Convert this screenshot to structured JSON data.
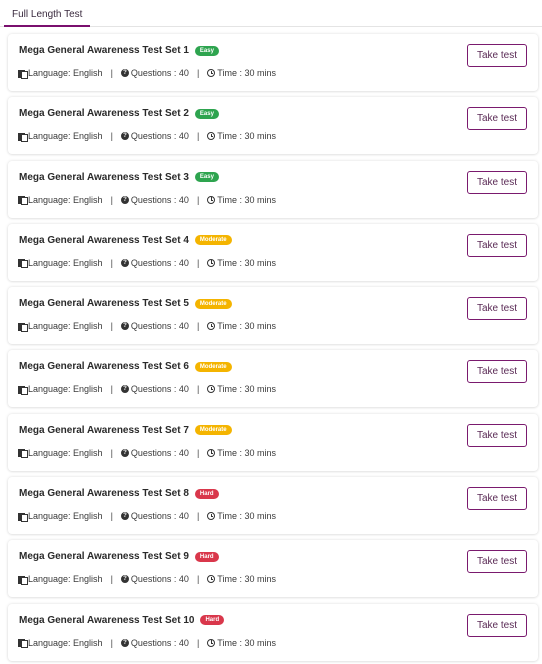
{
  "tabs": [
    {
      "label": "Full Length Test",
      "active": true
    }
  ],
  "colors": {
    "accent": "#7a0f6e",
    "easy": "#2ea44f",
    "moderate": "#f4b400",
    "hard": "#d9374b"
  },
  "meta_labels": {
    "language": "Language: English",
    "questions": "Questions : 40",
    "time": "Time : 30 mins"
  },
  "button_label": "Take test",
  "tests": [
    {
      "title": "Mega General Awareness Test Set 1",
      "difficulty": "Easy",
      "level": "easy"
    },
    {
      "title": "Mega General Awareness Test Set 2",
      "difficulty": "Easy",
      "level": "easy"
    },
    {
      "title": "Mega General Awareness Test Set 3",
      "difficulty": "Easy",
      "level": "easy"
    },
    {
      "title": "Mega General Awareness Test Set 4",
      "difficulty": "Moderate",
      "level": "moderate"
    },
    {
      "title": "Mega General Awareness Test Set 5",
      "difficulty": "Moderate",
      "level": "moderate"
    },
    {
      "title": "Mega General Awareness Test Set 6",
      "difficulty": "Moderate",
      "level": "moderate"
    },
    {
      "title": "Mega General Awareness Test Set 7",
      "difficulty": "Moderate",
      "level": "moderate"
    },
    {
      "title": "Mega General Awareness Test Set 8",
      "difficulty": "Hard",
      "level": "hard"
    },
    {
      "title": "Mega General Awareness Test Set 9",
      "difficulty": "Hard",
      "level": "hard"
    },
    {
      "title": "Mega General Awareness Test Set 10",
      "difficulty": "Hard",
      "level": "hard"
    }
  ]
}
